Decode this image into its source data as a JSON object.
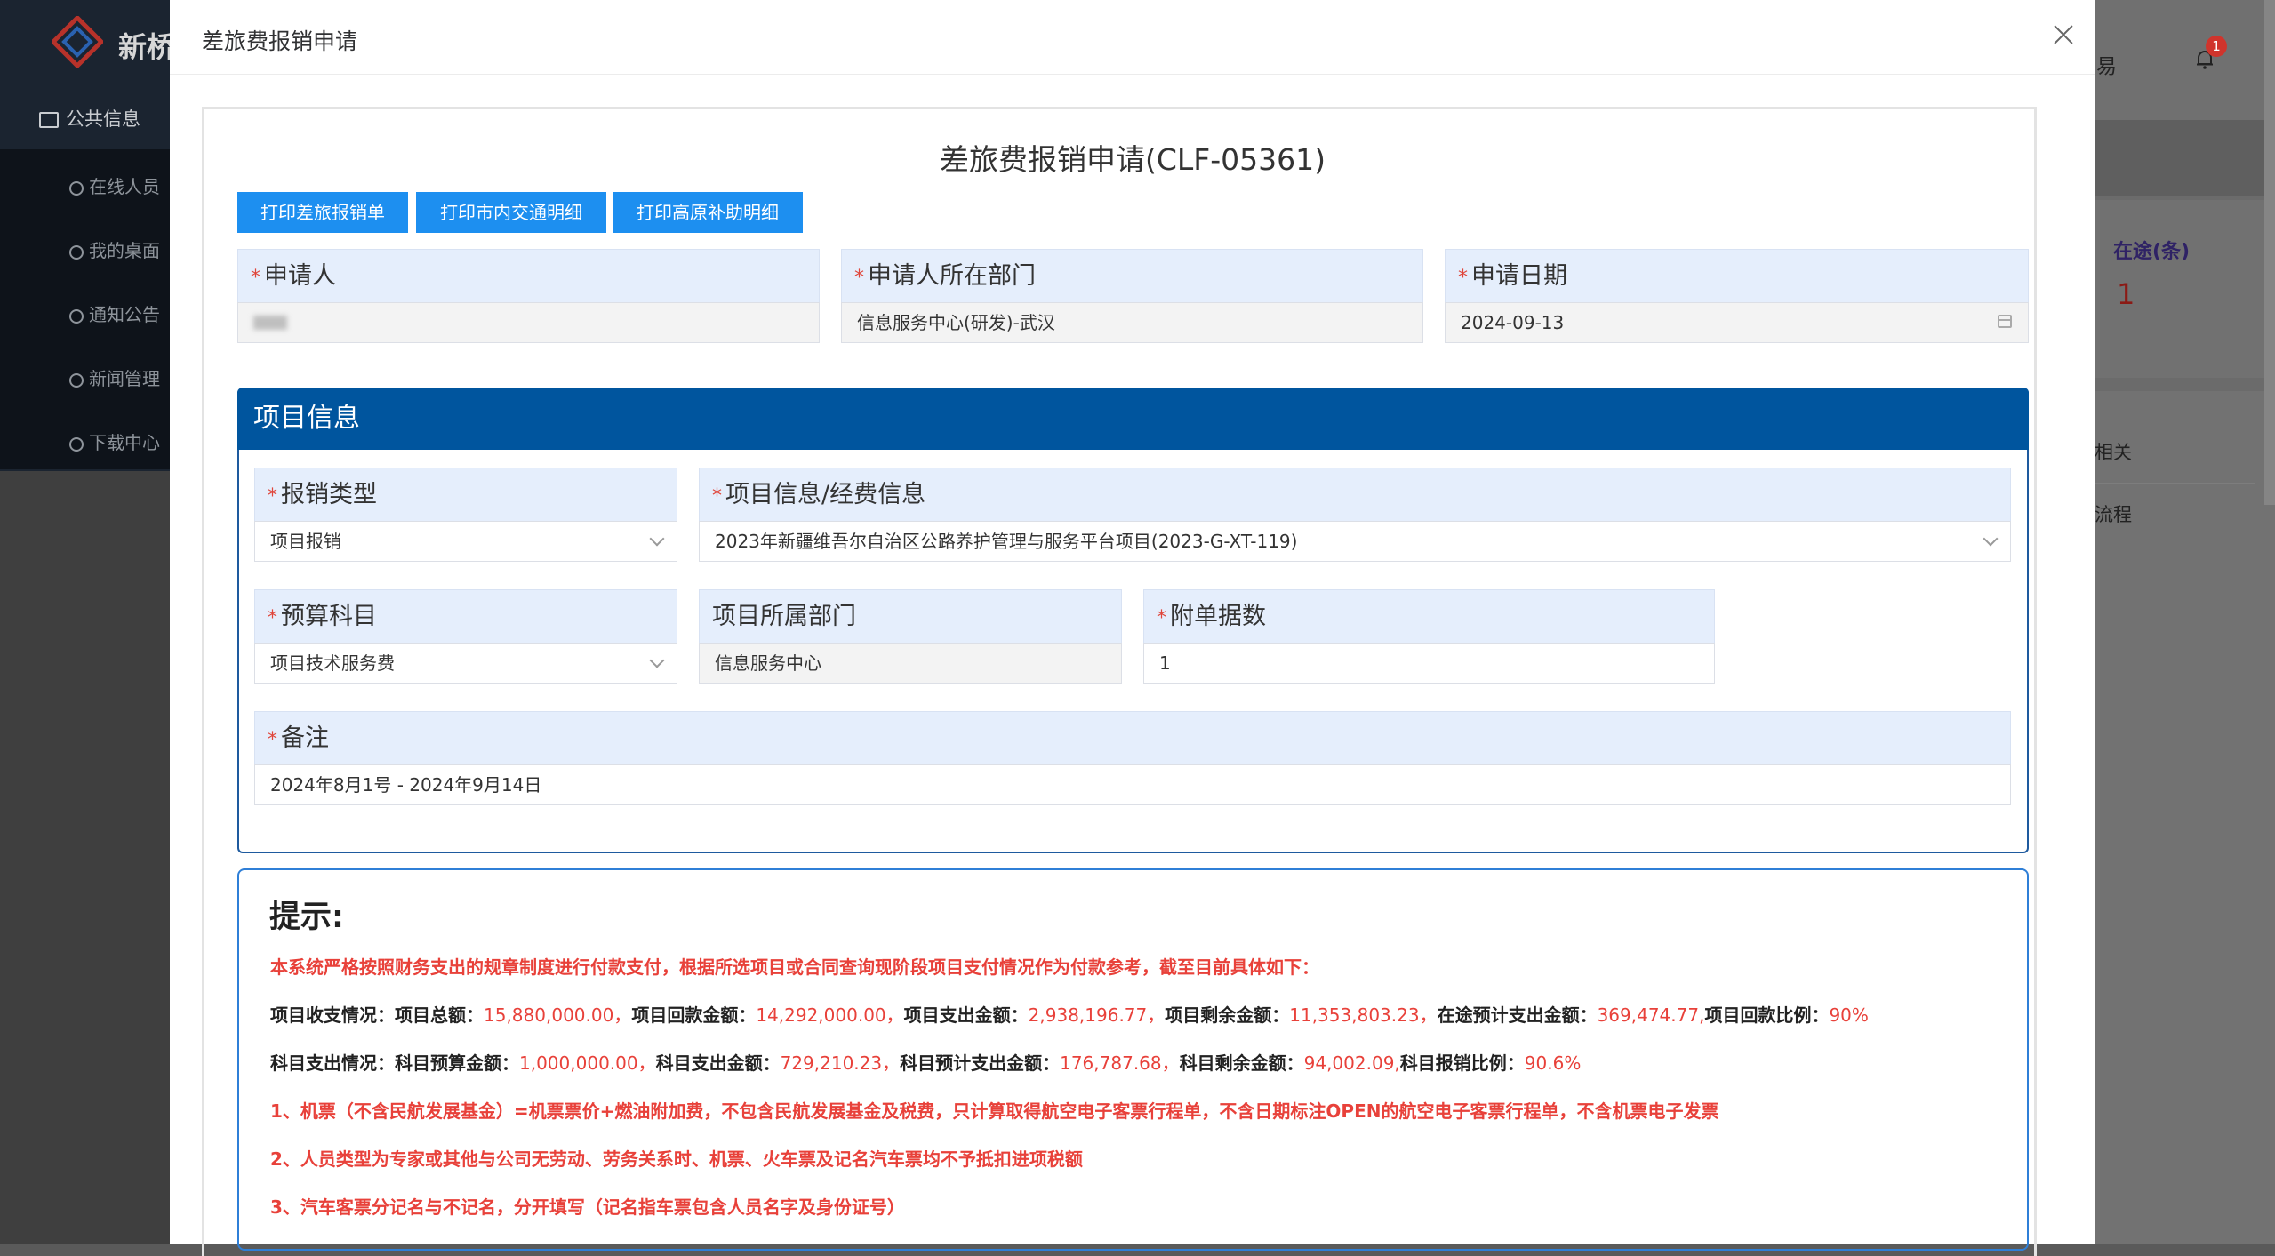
{
  "background": {
    "brand": "新桥",
    "menu_title": "公共信息",
    "menu_items": [
      "在线人员",
      "我的桌面",
      "通知公告",
      "新闻管理",
      "下载中心"
    ],
    "right_top_text": "易",
    "notification_count": "1",
    "onway_label": "在途(条)",
    "onway_value": "1",
    "right_list": [
      "相关",
      "流程"
    ]
  },
  "modal": {
    "title": "差旅费报销申请",
    "doc_title": "差旅费报销申请(CLF-05361)",
    "buttons": {
      "print_travel": "打印差旅报销单",
      "print_city": "打印市内交通明细",
      "print_plateau": "打印高原补助明细"
    },
    "applicant": {
      "label": "申请人",
      "value": ""
    },
    "department": {
      "label": "申请人所在部门",
      "value": "信息服务中心(研发)-武汉"
    },
    "apply_date": {
      "label": "申请日期",
      "value": "2024-09-13"
    },
    "project_section": {
      "title": "项目信息",
      "reimburse_type": {
        "label": "报销类型",
        "value": "项目报销"
      },
      "project_info": {
        "label": "项目信息/经费信息",
        "value": "2023年新疆维吾尔自治区公路养护管理与服务平台项目(2023-G-XT-119)"
      },
      "budget_subject": {
        "label": "预算科目",
        "value": "项目技术服务费"
      },
      "project_dept": {
        "label": "项目所属部门",
        "value": "信息服务中心"
      },
      "attachments": {
        "label": "附单据数",
        "value": "1"
      },
      "remark": {
        "label": "备注",
        "value": "2024年8月1号 - 2024年9月14日"
      }
    },
    "tips": {
      "title": "提示:",
      "intro": "本系统严格按照财务支出的规章制度进行付款支付，根据所选项目或合同查询现阶段项目支付情况作为付款参考，截至目前具体如下：",
      "project_summary": {
        "head": "项目收支情况：",
        "total_label": "项目总额：",
        "total": "15,880,000.00，",
        "returned_label": "项目回款金额：",
        "returned": "14,292,000.00，",
        "spent_label": "项目支出金额：",
        "spent": "2,938,196.77，",
        "remain_label": "项目剩余金额：",
        "remain": "11,353,803.23，",
        "onway_label": "在途预计支出金额：",
        "onway": "369,474.77,",
        "ratio_label": "项目回款比例：",
        "ratio": "90%"
      },
      "subject_summary": {
        "head": "科目支出情况：",
        "budget_label": "科目预算金额：",
        "budget": "1,000,000.00，",
        "spent_label": "科目支出金额：",
        "spent": "729,210.23，",
        "expected_label": "科目预计支出金额：",
        "expected": "176,787.68，",
        "remain_label": "科目剩余金额：",
        "remain": "94,002.09,",
        "ratio_label": "科目报销比例：",
        "ratio": "90.6%"
      },
      "rules": [
        "1、机票（不含民航发展基金）=机票票价+燃油附加费，不包含民航发展基金及税费，只计算取得航空电子客票行程单，不含日期标注OPEN的航空电子客票行程单，不含机票电子发票",
        "2、人员类型为专家或其他与公司无劳动、劳务关系时、机票、火车票及记名汽车票均不予抵扣进项税额",
        "3、汽车客票分记名与不记名，分开填写（记名指车票包含人员名字及身份证号）"
      ]
    }
  }
}
